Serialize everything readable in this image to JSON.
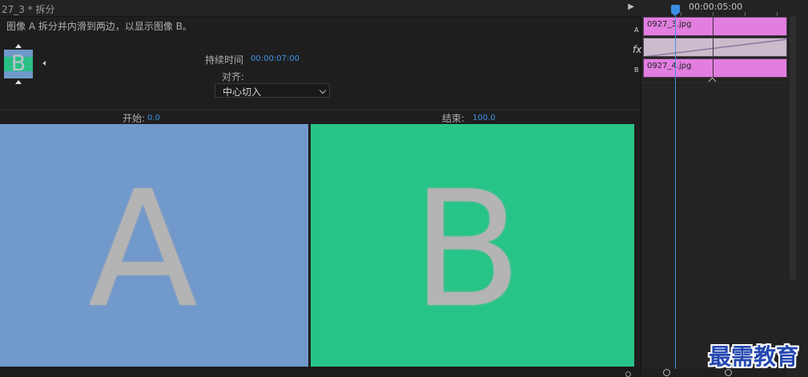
{
  "panel": {
    "title": "27_3 * 拆分",
    "description": "图像 A 拆分并内滑到两边，以显示图像 B。",
    "thumbnail_letter": "B",
    "duration_label": "持续时间",
    "duration_value": "00:00:07:00",
    "alignment_label": "对齐:",
    "alignment_value": "中心切入",
    "start_label": "开始:",
    "start_value": "0.0",
    "end_label": "结束:",
    "end_value": "100.0"
  },
  "preview": {
    "a_letter": "A",
    "b_letter": "B",
    "a_color": "#7299cb",
    "b_color": "#27c487"
  },
  "timeline": {
    "timecode": "00:00:05:00",
    "track_a_label": "A",
    "track_b_label": "B",
    "fx_label": "fx",
    "clip_a_name": "0927_3.jpg",
    "clip_b_name": "0927_4.jpg",
    "clip_color": "#e17ee0",
    "playhead_color": "#3b8ee5"
  },
  "watermark": "最需教育"
}
